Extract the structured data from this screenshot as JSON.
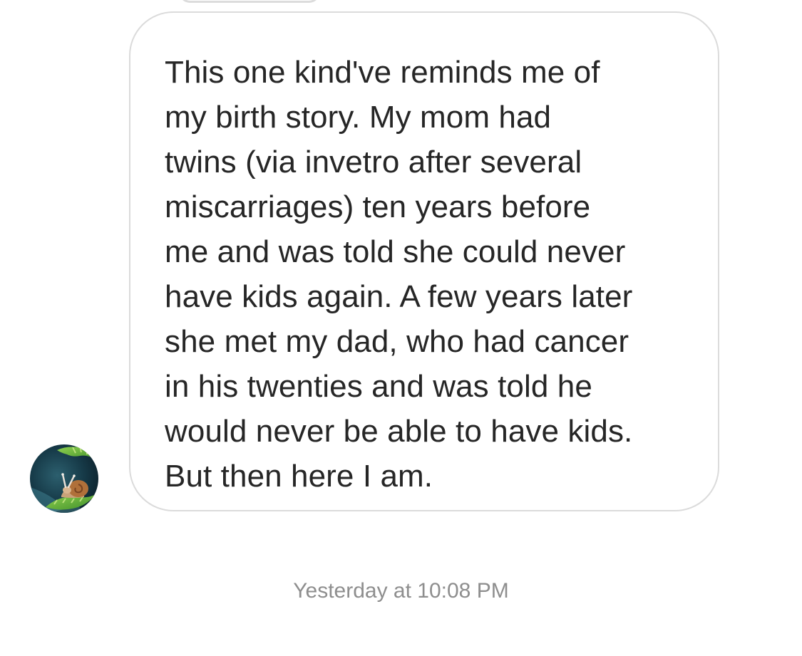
{
  "conversation": {
    "message": {
      "text": "This one kind've reminds me of\nmy birth story. My mom had\ntwins (via invetro after several\nmiscarriages) ten years before\nme and was told she could never\nhave kids again. A few years later\nshe met my dad, who had cancer\nin his twenties and was told he\nwould never be able to have kids.\nBut then here I am."
    },
    "sender": {
      "avatar_icon": "snail-photo-avatar"
    },
    "timestamp": "Yesterday at 10:08 PM"
  },
  "colors": {
    "bubble_border": "#dbdbdb",
    "message_text": "#262626",
    "timestamp_text": "#8e8e8e",
    "background": "#ffffff"
  }
}
